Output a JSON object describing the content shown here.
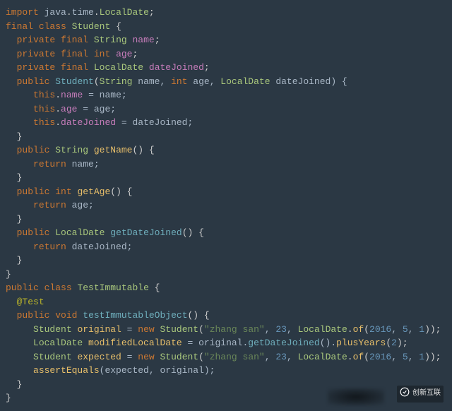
{
  "code": {
    "l1": {
      "kw1": "import",
      "pkg": " java",
      "dot1": ".",
      "time": "time",
      "dot2": ".",
      "type": "LocalDate",
      "semi": ";"
    },
    "l2": {
      "kw1": "final",
      "kw2": "class",
      "type": "Student",
      "br": " {"
    },
    "l3": {
      "kw1": "private",
      "kw2": "final",
      "type": "String",
      "name": "name",
      "semi": ";"
    },
    "l4": {
      "kw1": "private",
      "kw2": "final",
      "kw3": "int",
      "name": "age",
      "semi": ";"
    },
    "l5": {
      "kw1": "private",
      "kw2": "final",
      "type": "LocalDate",
      "name": "dateJoined",
      "semi": ";"
    },
    "l6": {
      "kw1": "public",
      "ctor": "Student",
      "p1": "(",
      "t1": "String",
      "a1": " name, ",
      "kw2": "int",
      "a2": " age, ",
      "t2": "LocalDate",
      "a3": " dateJoined) {"
    },
    "l7": {
      "kw1": "this",
      "dot": ".",
      "field": "name",
      "rest": " = name;"
    },
    "l8": {
      "kw1": "this",
      "dot": ".",
      "field": "age",
      "rest": " = age;"
    },
    "l9": {
      "kw1": "this",
      "dot": ".",
      "field": "dateJoined",
      "rest": " = dateJoined;"
    },
    "l10": {
      "br": "}"
    },
    "l11": {
      "kw1": "public",
      "type": "String",
      "method": "getName",
      "rest": "() {"
    },
    "l12": {
      "kw1": "return",
      "rest": " name;"
    },
    "l13": {
      "br": "}"
    },
    "l14": {
      "kw1": "public",
      "kw2": "int",
      "method": "getAge",
      "rest": "() {"
    },
    "l15": {
      "kw1": "return",
      "rest": " age;"
    },
    "l16": {
      "br": "}"
    },
    "l17": {
      "kw1": "public",
      "type": "LocalDate",
      "method": "getDateJoined",
      "rest": "() {"
    },
    "l18": {
      "kw1": "return",
      "rest": " dateJoined;"
    },
    "l19": {
      "br": "}"
    },
    "l20": {
      "br": "}"
    },
    "l21": {
      "kw1": "public",
      "kw2": "class",
      "type": "TestImmutable",
      "br": " {"
    },
    "l22": {
      "anno": "@Test"
    },
    "l23": {
      "kw1": "public",
      "kw2": "void",
      "method": "testImmutableObject",
      "rest": "() {"
    },
    "l24": {
      "t1": "Student",
      "var": "original",
      "eq": " = ",
      "kw1": "new",
      "t2": "Student",
      "p1": "(",
      "s1": "\"zhang san\"",
      "c1": ", ",
      "n1": "23",
      "c2": ", ",
      "t3": "LocalDate",
      "dot": ".",
      "m1": "of",
      "p2": "(",
      "n2": "2016",
      "c3": ", ",
      "n3": "5",
      "c4": ", ",
      "n4": "1",
      "p3": "));"
    },
    "l25": {
      "t1": "LocalDate",
      "var": "modifiedLocalDate",
      "eq": " = original.",
      "m1": "getDateJoined",
      "mid": "().",
      "m2": "plusYears",
      "p1": "(",
      "n1": "2",
      "p2": ");"
    },
    "l26": {
      "t1": "Student",
      "var": "expected",
      "eq": " = ",
      "kw1": "new",
      "t2": "Student",
      "p1": "(",
      "s1": "\"zhang san\"",
      "c1": ", ",
      "n1": "23",
      "c2": ", ",
      "t3": "LocalDate",
      "dot": ".",
      "m1": "of",
      "p2": "(",
      "n2": "2016",
      "c3": ", ",
      "n3": "5",
      "c4": ", ",
      "n4": "1",
      "p3": "));"
    },
    "l27": {
      "m1": "assertEquals",
      "rest": "(expected, original);"
    },
    "l28": {
      "br": "}"
    },
    "l29": {
      "br": "}"
    }
  },
  "watermark": {
    "text": "创新互联"
  }
}
